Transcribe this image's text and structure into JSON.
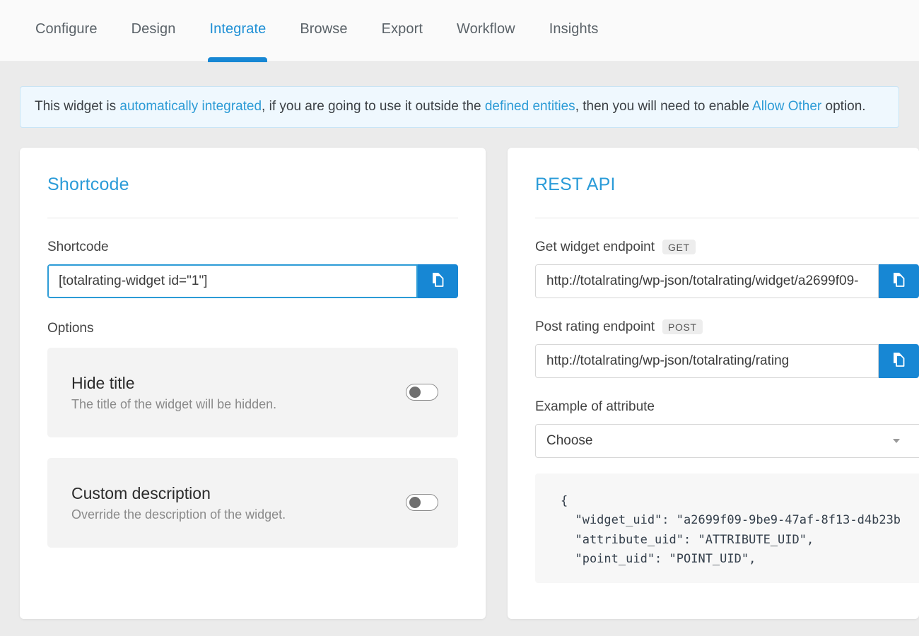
{
  "tabs": [
    {
      "label": "Configure",
      "active": false
    },
    {
      "label": "Design",
      "active": false
    },
    {
      "label": "Integrate",
      "active": true
    },
    {
      "label": "Browse",
      "active": false
    },
    {
      "label": "Export",
      "active": false
    },
    {
      "label": "Workflow",
      "active": false
    },
    {
      "label": "Insights",
      "active": false
    }
  ],
  "banner": {
    "part1": "This widget is ",
    "link1": "automatically integrated",
    "part2": ", if you are going to use it outside the ",
    "link2": "defined entities",
    "part3": ", then you will need to enable ",
    "link3": "Allow Other",
    "part4": " option."
  },
  "shortcode_panel": {
    "title": "Shortcode",
    "field_label": "Shortcode",
    "field_value": "[totalrating-widget id=\"1\"]",
    "copy_icon": "copy-icon",
    "options_label": "Options",
    "options": [
      {
        "title": "Hide title",
        "description": "The title of the widget will be hidden.",
        "toggle_state": "off"
      },
      {
        "title": "Custom description",
        "description": "Override the description of the widget.",
        "toggle_state": "off"
      }
    ]
  },
  "rest_api_panel": {
    "title": "REST API",
    "get_endpoint": {
      "label": "Get widget endpoint",
      "method": "GET",
      "value": "http://totalrating/wp-json/totalrating/widget/a2699f09-"
    },
    "post_endpoint": {
      "label": "Post rating endpoint",
      "method": "POST",
      "value": "http://totalrating/wp-json/totalrating/rating"
    },
    "attribute_example": {
      "label": "Example of attribute",
      "selected": "Choose"
    },
    "code_sample": "{\n  \"widget_uid\": \"a2699f09-9be9-47af-8f13-d4b23b\n  \"attribute_uid\": \"ATTRIBUTE_UID\",\n  \"point_uid\": \"POINT_UID\","
  },
  "colors": {
    "accent": "#1787d4",
    "link": "#2c9bd6",
    "page_bg": "#ebebeb",
    "banner_bg": "#eff8fe"
  }
}
